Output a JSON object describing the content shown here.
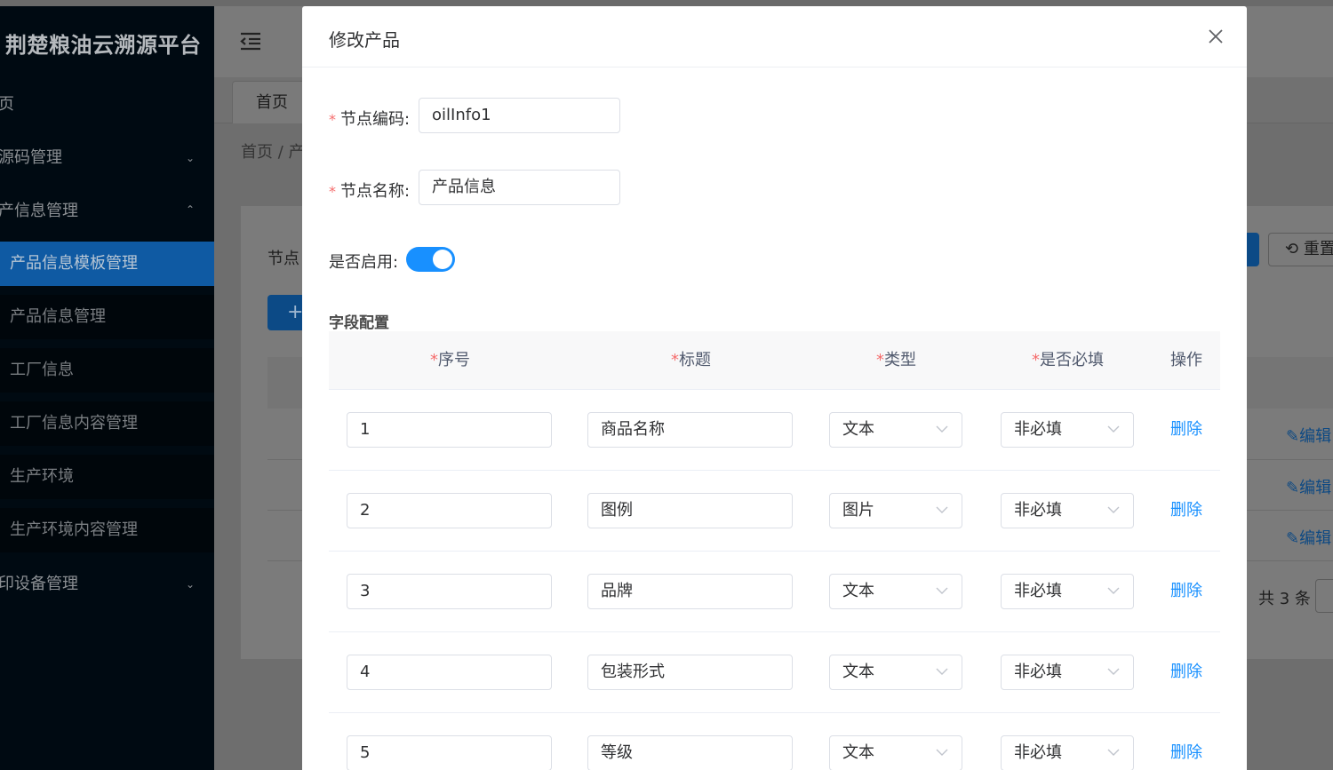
{
  "sidebar": {
    "title": "荆楚粮油云溯源平台",
    "items": [
      {
        "label": "页"
      },
      {
        "label": "源码管理"
      },
      {
        "label": "产信息管理"
      },
      {
        "label": "印设备管理"
      }
    ],
    "subitems": [
      {
        "label": "产品信息模板管理"
      },
      {
        "label": "产品信息管理"
      },
      {
        "label": "工厂信息"
      },
      {
        "label": "工厂信息内容管理"
      },
      {
        "label": "生产环境"
      },
      {
        "label": "生产环境内容管理"
      }
    ]
  },
  "background": {
    "tab_home": "首页",
    "breadcrumb": "首页 / 产",
    "filter_label": "节点",
    "add_icon": "+",
    "reset_label": "重置",
    "edit_label": "编辑",
    "total": "共 3 条"
  },
  "modal": {
    "title": "修改产品",
    "code_label": "节点编码:",
    "code_value": "oilInfo1",
    "name_label": "节点名称:",
    "name_value": "产品信息",
    "enable_label": "是否启用:",
    "enabled": true,
    "section_title": "字段配置",
    "required_mark": "*",
    "columns": {
      "index": "序号",
      "title": "标题",
      "type": "类型",
      "required": "是否必填",
      "action": "操作"
    },
    "rows": [
      {
        "index": "1",
        "title": "商品名称",
        "type": "文本",
        "required": "非必填",
        "action": "删除"
      },
      {
        "index": "2",
        "title": "图例",
        "type": "图片",
        "required": "非必填",
        "action": "删除"
      },
      {
        "index": "3",
        "title": "品牌",
        "type": "文本",
        "required": "非必填",
        "action": "删除"
      },
      {
        "index": "4",
        "title": "包装形式",
        "type": "文本",
        "required": "非必填",
        "action": "删除"
      },
      {
        "index": "5",
        "title": "等级",
        "type": "文本",
        "required": "非必填",
        "action": "删除"
      }
    ]
  },
  "colors": {
    "primary": "#1890ff",
    "danger_star": "#f56c6c",
    "sidebar_bg": "#000a12",
    "sidebar_active": "#0f5aa3"
  }
}
